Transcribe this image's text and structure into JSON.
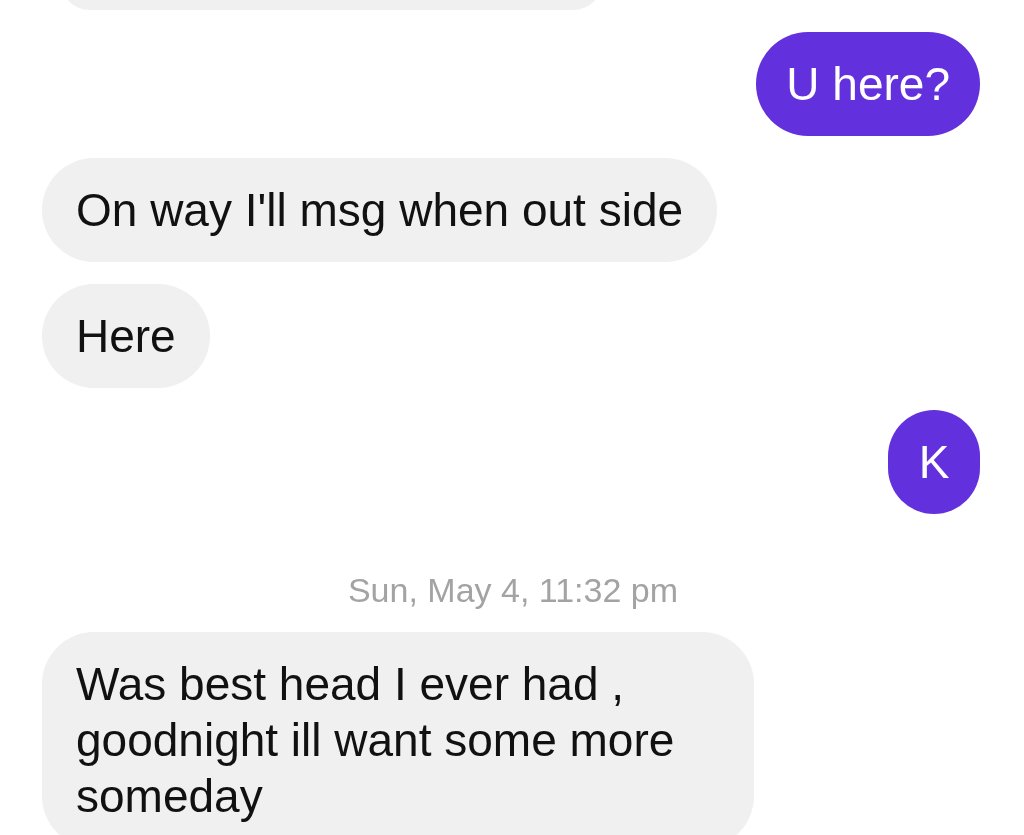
{
  "messages": [
    {
      "kind": "incoming"
    },
    {
      "kind": "outgoing",
      "text": "U here?"
    },
    {
      "kind": "incoming",
      "text": "On way I'll msg when out side"
    },
    {
      "kind": "incoming",
      "text": "Here"
    },
    {
      "kind": "outgoing",
      "text": "K"
    },
    {
      "kind": "timestamp",
      "text": "Sun, May 4, 11:32 pm"
    },
    {
      "kind": "incoming",
      "text": "Was best head I ever had , goodnight ill want some more someday"
    }
  ]
}
